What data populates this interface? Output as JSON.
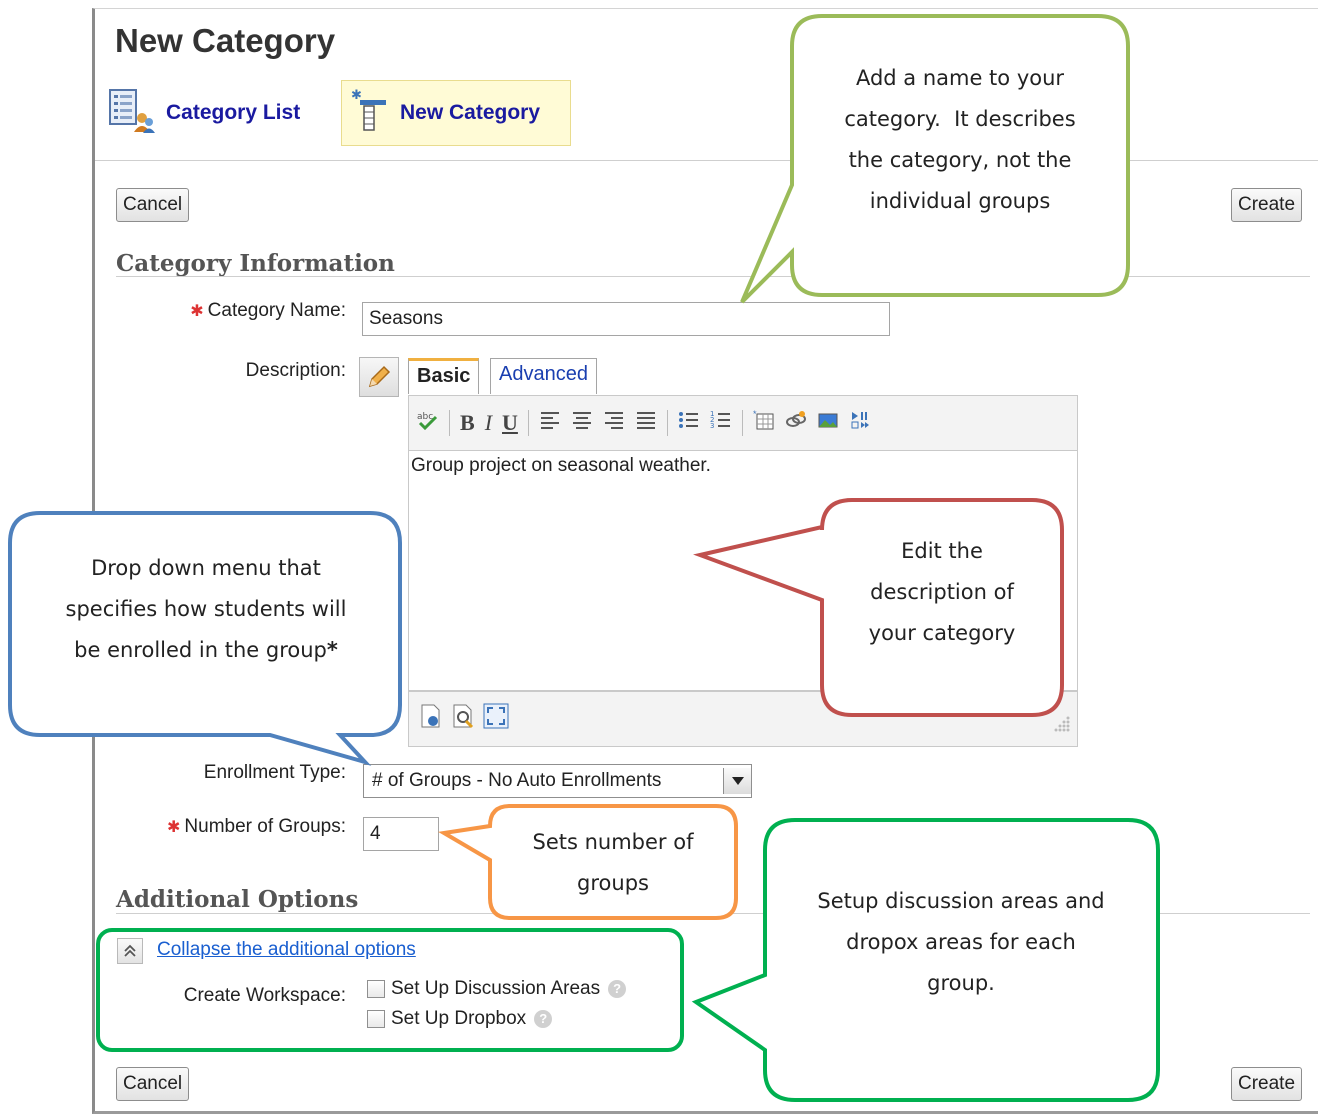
{
  "page": {
    "title": "New Category"
  },
  "nav": {
    "category_list_label": "Category List",
    "new_category_label": "New Category"
  },
  "buttons": {
    "cancel_label": "Cancel",
    "create_label": "Create"
  },
  "category_information": {
    "section_title": "Category Information",
    "category_name_label": "Category Name:",
    "category_name_value": "Seasons",
    "description_label": "Description:",
    "editor_tabs": [
      "Basic",
      "Advanced"
    ],
    "active_editor_tab": "Basic",
    "description_value": "Group project on seasonal weather.",
    "enrollment_type_label": "Enrollment Type:",
    "enrollment_type_value": "# of Groups - No Auto Enrollments",
    "number_of_groups_label": "Number of Groups:",
    "number_of_groups_value": "4"
  },
  "toolbar": {
    "bold": "B",
    "italic": "I",
    "underline": "U"
  },
  "additional_options": {
    "section_title": "Additional Options",
    "collapse_link": "Collapse the additional options",
    "workspace_label": "Create Workspace:",
    "option_discussion": "Set Up Discussion Areas",
    "option_dropbox": "Set Up Dropbox"
  },
  "callouts": {
    "name": [
      "Add a name to your",
      "category.  It describes",
      "the category, not the",
      "individual groups"
    ],
    "description": [
      "Edit the",
      "description of",
      "your category"
    ],
    "enrollment": [
      "Drop down menu that",
      "specifies how students will",
      "be enrolled in the group"
    ],
    "enrollment_mark": "*",
    "groups": [
      "Sets number of",
      "groups"
    ],
    "workspace": [
      "Setup discussion areas and",
      "dropox areas for each",
      "group."
    ]
  },
  "colors": {
    "callout_name": "#9bbb59",
    "callout_description": "#c0504d",
    "callout_enrollment": "#4f81bd",
    "callout_groups": "#f79646",
    "callout_workspace": "#00b050",
    "nav_link": "#1a1aa0",
    "required_marker": "#dd3333"
  }
}
